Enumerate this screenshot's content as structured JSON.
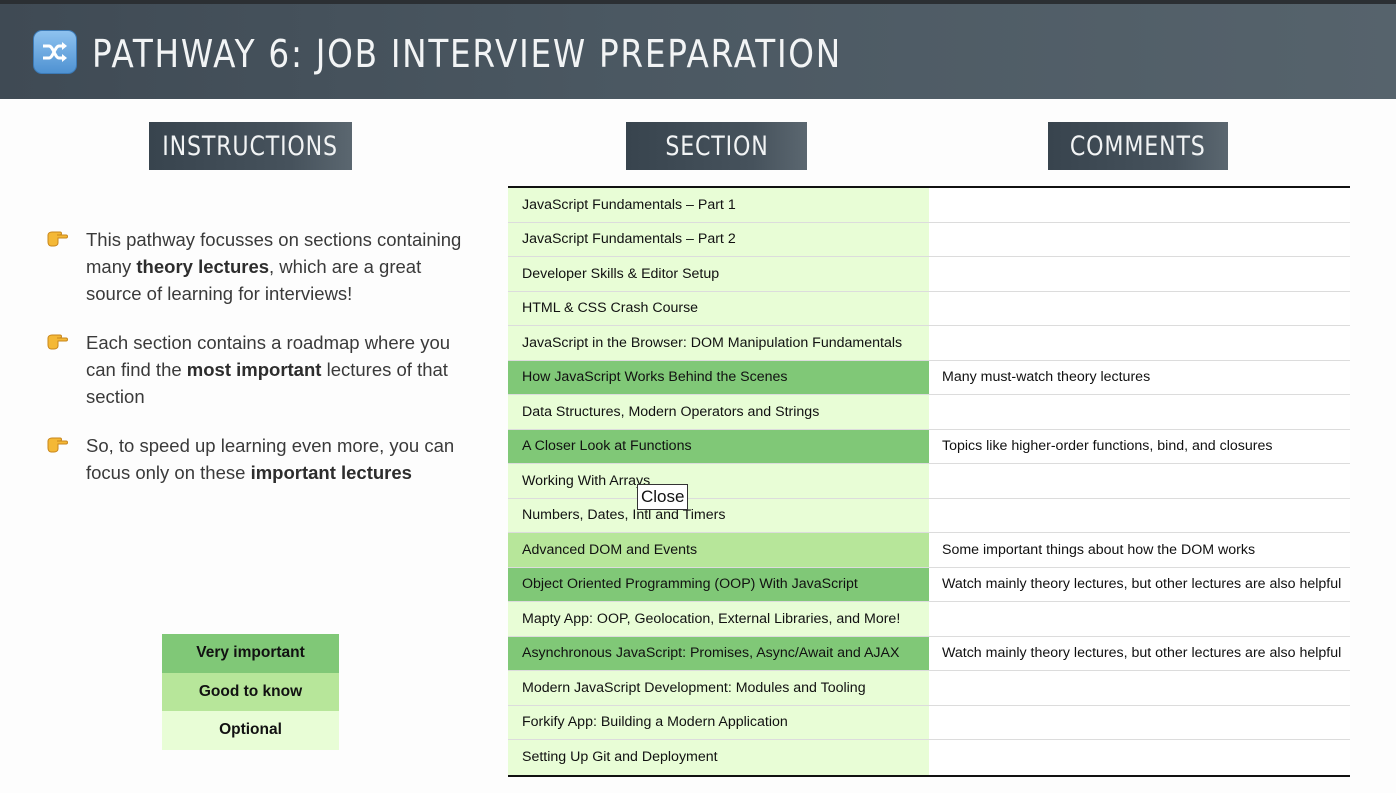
{
  "header": {
    "icon": "shuffle-icon",
    "title": "PATHWAY 6: JOB INTERVIEW PREPARATION"
  },
  "columns": {
    "instructions": "Instructions",
    "section": "Section",
    "comments": "Comments"
  },
  "instructions": [
    {
      "icon": "pointing-hand-icon",
      "before": "This pathway focusses on sections containing many ",
      "bold": "theory lectures",
      "after": ", which are a great source of learning for interviews!"
    },
    {
      "icon": "pointing-hand-icon",
      "before": "Each section contains a roadmap where you can find the ",
      "bold": "most important",
      "after": " lectures of that section"
    },
    {
      "icon": "pointing-hand-icon",
      "before": "So, to speed up learning even more, you can focus only on these ",
      "bold": "important lectures",
      "after": ""
    }
  ],
  "legend": [
    {
      "label": "Very important",
      "level": "very",
      "color": "#80c877"
    },
    {
      "label": "Good to know",
      "level": "good",
      "color": "#b7e69a"
    },
    {
      "label": "Optional",
      "level": "opt",
      "color": "#e8fdd6"
    }
  ],
  "rows": [
    {
      "section": "JavaScript Fundamentals – Part 1",
      "level": "opt",
      "comment": ""
    },
    {
      "section": "JavaScript Fundamentals – Part 2",
      "level": "opt",
      "comment": ""
    },
    {
      "section": "Developer Skills & Editor Setup",
      "level": "opt",
      "comment": ""
    },
    {
      "section": "HTML & CSS Crash Course",
      "level": "opt",
      "comment": ""
    },
    {
      "section": "JavaScript in the Browser: DOM Manipulation Fundamentals",
      "level": "opt",
      "comment": ""
    },
    {
      "section": "How JavaScript Works Behind the Scenes",
      "level": "very",
      "comment": "Many must-watch theory lectures"
    },
    {
      "section": "Data Structures, Modern Operators and Strings",
      "level": "opt",
      "comment": ""
    },
    {
      "section": "A Closer Look at Functions",
      "level": "very",
      "comment": "Topics like higher-order functions, bind, and closures"
    },
    {
      "section": "Working With Arrays",
      "level": "opt",
      "comment": ""
    },
    {
      "section": "Numbers, Dates, Intl and Timers",
      "level": "opt",
      "comment": ""
    },
    {
      "section": "Advanced DOM and Events",
      "level": "good",
      "comment": "Some important things about how the DOM works"
    },
    {
      "section": "Object Oriented Programming (OOP) With JavaScript",
      "level": "very",
      "comment": "Watch mainly theory lectures, but other lectures are also helpful"
    },
    {
      "section": "Mapty App: OOP, Geolocation, External Libraries, and More!",
      "level": "opt",
      "comment": ""
    },
    {
      "section": "Asynchronous JavaScript: Promises, Async/Await and AJAX",
      "level": "very",
      "comment": "Watch mainly theory lectures, but other lectures are also helpful"
    },
    {
      "section": "Modern JavaScript Development: Modules and Tooling",
      "level": "opt",
      "comment": ""
    },
    {
      "section": "Forkify App: Building a Modern Application",
      "level": "opt",
      "comment": ""
    },
    {
      "section": "Setting Up Git and Deployment",
      "level": "opt",
      "comment": ""
    }
  ],
  "tooltip": "Close"
}
